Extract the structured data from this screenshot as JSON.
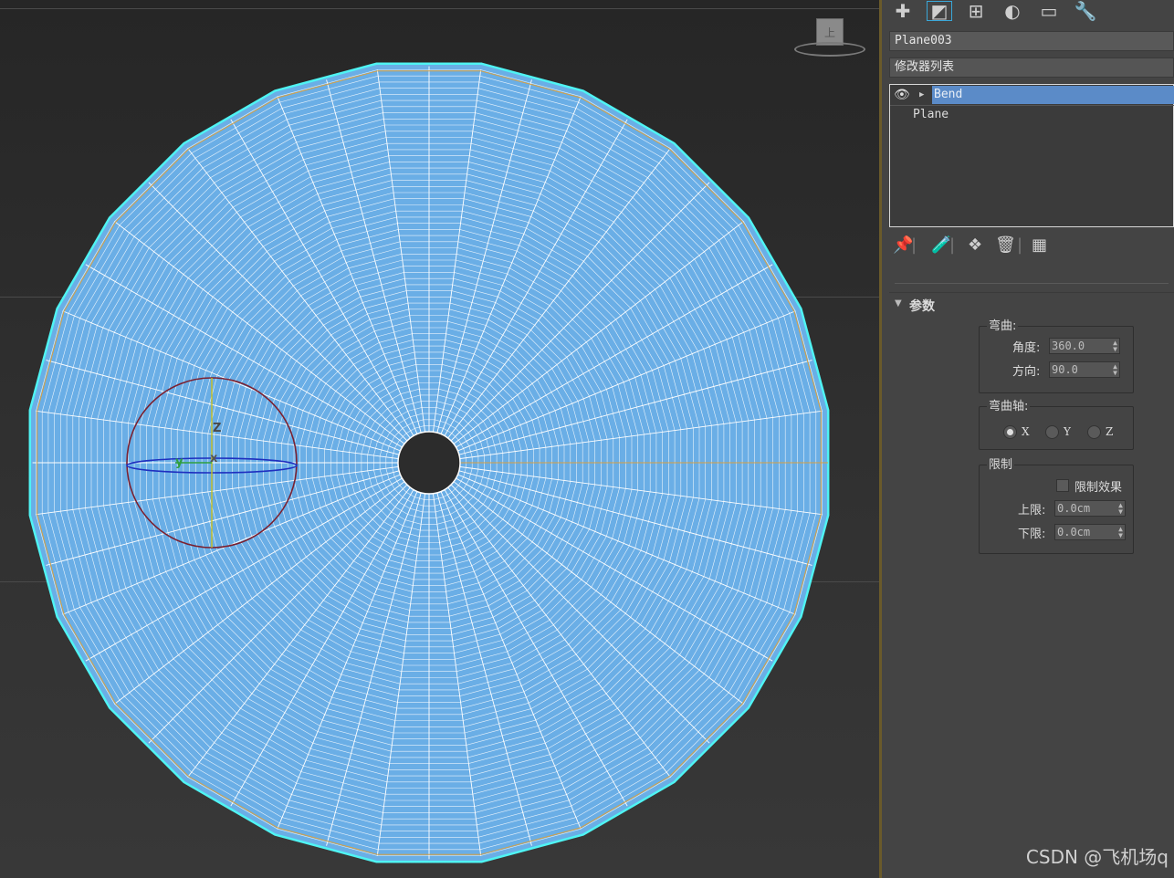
{
  "toolbar": {
    "icons": [
      "create-icon",
      "modify-icon",
      "hierarchy-icon",
      "motion-icon",
      "display-icon",
      "utilities-icon"
    ],
    "glyphs": [
      "✚",
      "◩",
      "⊞",
      "◐",
      "▭",
      "🔧"
    ]
  },
  "object_name": "Plane003",
  "modifier_list_label": "修改器列表",
  "modifier_stack": {
    "items": [
      {
        "label": "Bend",
        "selected": true
      },
      {
        "label": "Plane",
        "selected": false
      }
    ]
  },
  "stack_icons": [
    "pin-icon",
    "show-end-result-icon",
    "make-unique-icon",
    "remove-modifier-icon",
    "configure-sets-icon"
  ],
  "rollout": {
    "title": "参数",
    "bend_group": {
      "title": "弯曲:",
      "angle_label": "角度:",
      "angle_value": "360.0",
      "direction_label": "方向:",
      "direction_value": "90.0"
    },
    "axis_group": {
      "title": "弯曲轴:",
      "options": [
        "X",
        "Y",
        "Z"
      ],
      "selected": "X"
    },
    "limits_group": {
      "title": "限制",
      "limit_effect_label": "限制效果",
      "limit_effect_checked": false,
      "upper_label": "上限:",
      "upper_value": "0.0cm",
      "lower_label": "下限:",
      "lower_value": "0.0cm"
    }
  },
  "gizmo_labels": {
    "z": "Z",
    "y": "y",
    "x": "x"
  },
  "viewcube_label": "上",
  "watermark": "CSDN @飞机场q",
  "colors": {
    "mesh_fill": "#6aaee6",
    "mesh_wire": "#ffffff",
    "selection_outline": "#4ff3f3",
    "gizmo_circle": "#7a2030",
    "panel_bg": "#444444",
    "selected_modifier": "#5b8bc8"
  }
}
